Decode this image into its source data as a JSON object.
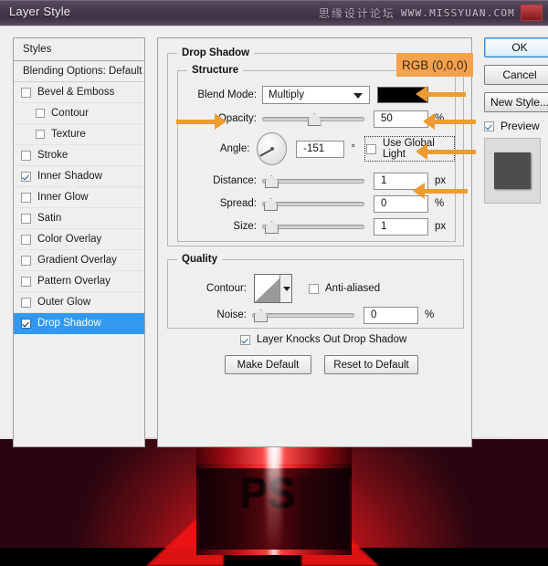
{
  "window": {
    "title": "Layer Style",
    "watermark_cn": "思缘设计论坛",
    "watermark_en": "WWW.MISSYUAN.COM"
  },
  "styles_panel": {
    "header": "Styles",
    "blending_options": "Blending Options: Default",
    "items": [
      {
        "label": "Bevel & Emboss",
        "checked": false,
        "indent": false,
        "selected": false
      },
      {
        "label": "Contour",
        "checked": false,
        "indent": true,
        "selected": false
      },
      {
        "label": "Texture",
        "checked": false,
        "indent": true,
        "selected": false
      },
      {
        "label": "Stroke",
        "checked": false,
        "indent": false,
        "selected": false
      },
      {
        "label": "Inner Shadow",
        "checked": true,
        "indent": false,
        "selected": false
      },
      {
        "label": "Inner Glow",
        "checked": false,
        "indent": false,
        "selected": false
      },
      {
        "label": "Satin",
        "checked": false,
        "indent": false,
        "selected": false
      },
      {
        "label": "Color Overlay",
        "checked": false,
        "indent": false,
        "selected": false
      },
      {
        "label": "Gradient Overlay",
        "checked": false,
        "indent": false,
        "selected": false
      },
      {
        "label": "Pattern Overlay",
        "checked": false,
        "indent": false,
        "selected": false
      },
      {
        "label": "Outer Glow",
        "checked": false,
        "indent": false,
        "selected": false
      },
      {
        "label": "Drop Shadow",
        "checked": true,
        "indent": false,
        "selected": true
      }
    ]
  },
  "drop_shadow": {
    "group_title": "Drop Shadow",
    "structure": {
      "group_title": "Structure",
      "blend_mode_label": "Blend Mode:",
      "blend_mode_value": "Multiply",
      "shadow_color": "#000000",
      "opacity_label": "Opacity:",
      "opacity_value": "50",
      "opacity_unit": "%",
      "opacity_percent": 50,
      "angle_label": "Angle:",
      "angle_value": "-151",
      "angle_unit": "°",
      "angle_degrees": -151,
      "use_global_light_label": "Use Global Light",
      "use_global_light_checked": false,
      "distance_label": "Distance:",
      "distance_value": "1",
      "distance_unit": "px",
      "distance_percent": 3,
      "spread_label": "Spread:",
      "spread_value": "0",
      "spread_unit": "%",
      "spread_percent": 2,
      "size_label": "Size:",
      "size_value": "1",
      "size_unit": "px",
      "size_percent": 3
    },
    "quality": {
      "group_title": "Quality",
      "contour_label": "Contour:",
      "anti_aliased_label": "Anti-aliased",
      "anti_aliased_checked": false,
      "noise_label": "Noise:",
      "noise_value": "0",
      "noise_unit": "%",
      "noise_percent": 2
    },
    "knockout_label": "Layer Knocks Out Drop Shadow",
    "knockout_checked": true,
    "make_default_label": "Make Default",
    "reset_default_label": "Reset to Default"
  },
  "actions": {
    "ok_label": "OK",
    "cancel_label": "Cancel",
    "new_style_label": "New Style...",
    "preview_label": "Preview",
    "preview_checked": true
  },
  "annotations": {
    "rgb_badge": "RGB (0,0,0)",
    "accent_color": "#ee9b32",
    "badge_color": "#f5a14e"
  },
  "photo": {
    "can_letters": "PS"
  }
}
